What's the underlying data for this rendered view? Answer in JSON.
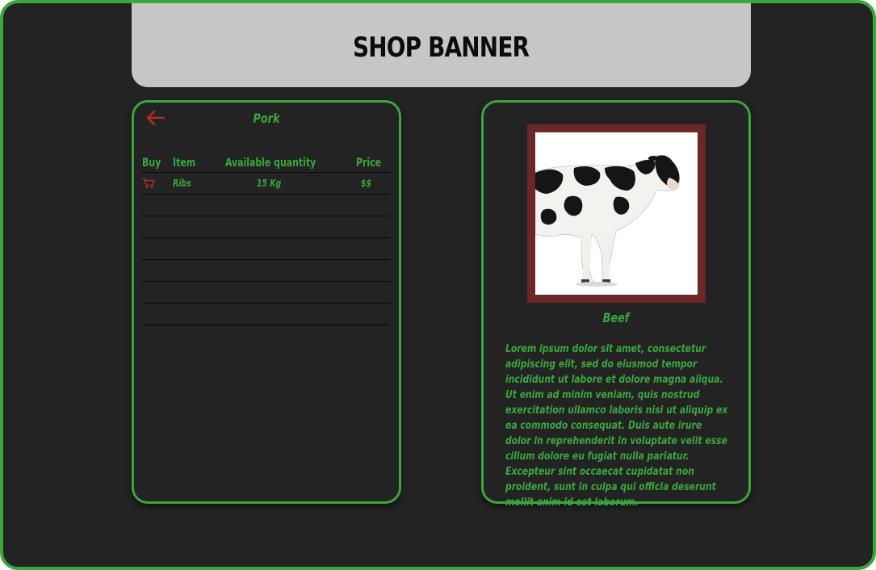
{
  "banner": {
    "title": "SHOP BANNER"
  },
  "cart_panel": {
    "title": "Pork",
    "back_icon": "arrow-left-icon",
    "columns": {
      "buy": "Buy",
      "item": "Item",
      "quantity": "Available quantity",
      "price": "Price"
    },
    "rows": [
      {
        "buy_icon": "cart-icon",
        "item": "Ribs",
        "quantity": "15 Kg",
        "price": "$$"
      }
    ],
    "empty_row_count_note": ""
  },
  "product_panel": {
    "image": "cow-photo",
    "name": "Beef",
    "description": "Lorem ipsum dolor sit amet, consectetur adipiscing elit, sed do eiusmod tempor incididunt ut labore et dolore magna aliqua. Ut enim ad minim veniam, quis nostrud exercitation ullamco laboris nisi ut aliquip ex ea commodo consequat. Duis aute irure dolor in reprehenderit in voluptate velit esse cillum dolore eu fugiat nulla pariatur. Excepteur sint occaecat cupidatat non proident, sunt in culpa qui officia deserunt mollit anim id est laborum."
  },
  "colors": {
    "accent": "#3aa63d",
    "background": "#232323",
    "banner": "#c6c6c6",
    "icon_red": "#b02a2a",
    "image_frame": "#6b2727"
  }
}
